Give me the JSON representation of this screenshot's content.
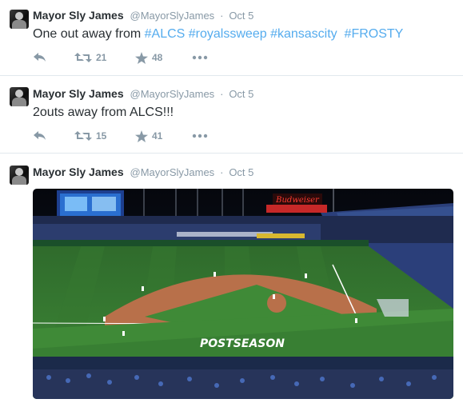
{
  "tweets": [
    {
      "name": "Mayor Sly James",
      "handle": "@MayorSlyJames",
      "dot": "·",
      "time": "Oct 5",
      "text_parts": [
        "One out away from ",
        "#ALCS",
        " ",
        "#royalssweep",
        " ",
        "#kansascity",
        "  ",
        "#FROSTY"
      ],
      "retweets": "21",
      "favorites": "48"
    },
    {
      "name": "Mayor Sly James",
      "handle": "@MayorSlyJames",
      "dot": "·",
      "time": "Oct 5",
      "text": "2outs away from ALCS!!!",
      "retweets": "15",
      "favorites": "41"
    },
    {
      "name": "Mayor Sly James",
      "handle": "@MayorSlyJames",
      "dot": "·",
      "time": "Oct 5",
      "photo": {
        "stadium_sign": "Budweiser",
        "field_text": "POSTSEASON"
      }
    }
  ],
  "colors": {
    "link": "#55acee",
    "meta": "#8899a6",
    "text": "#292f33",
    "divider": "#e1e8ed"
  },
  "icons": [
    "reply-icon",
    "retweet-icon",
    "favorite-icon",
    "more-icon"
  ]
}
